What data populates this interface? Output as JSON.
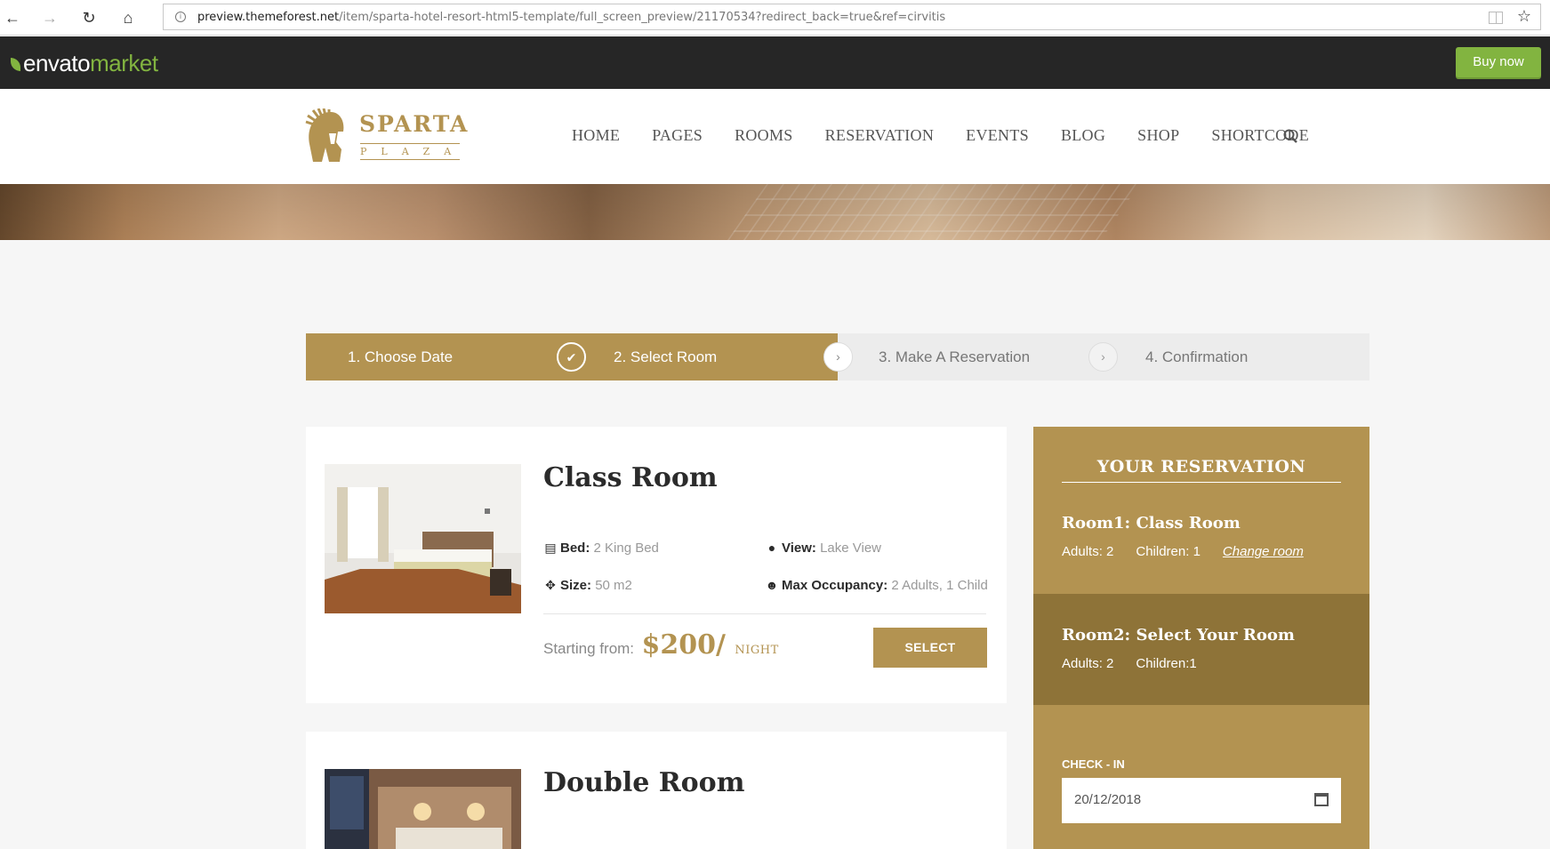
{
  "browser": {
    "url_host": "preview.themeforest.net",
    "url_path": "/item/sparta-hotel-resort-html5-template/full_screen_preview/21170534?redirect_back=true&ref=cirvitis"
  },
  "envato": {
    "logo_word": "envato",
    "logo_market": "market",
    "buy_now": "Buy now",
    "accent_color": "#82b440"
  },
  "site": {
    "brand_name": "SPARTA",
    "brand_sub": "PLAZA",
    "accent_color": "#b39351",
    "nav": [
      "Home",
      "Pages",
      "Rooms",
      "Reservation",
      "Events",
      "Blog",
      "Shop",
      "Shortcode"
    ]
  },
  "steps": [
    {
      "label": "1. Choose Date",
      "state": "done"
    },
    {
      "label": "2. Select Room",
      "state": "active"
    },
    {
      "label": "3. Make A Reservation",
      "state": "inactive"
    },
    {
      "label": "4. Confirmation",
      "state": "inactive"
    }
  ],
  "rooms": [
    {
      "name": "Class Room",
      "bed_label": "Bed:",
      "bed": "2 King Bed",
      "view_label": "View:",
      "view": "Lake View",
      "size_label": "Size:",
      "size": "50 m2",
      "occupancy_label": "Max Occupancy:",
      "occupancy": "2 Adults, 1 Child",
      "price_label": "Starting from:",
      "price": "$200/",
      "price_unit": "NIGHT",
      "select_label": "SELECT"
    },
    {
      "name": "Double Room"
    }
  ],
  "reservation": {
    "title": "YOUR RESERVATION",
    "room1_name": "Room1: Class Room",
    "room1_adults": "Adults: 2",
    "room1_children": "Children: 1",
    "change_room": "Change room",
    "room2_name": "Room2: Select Your Room",
    "room2_adults": "Adults: 2",
    "room2_children": "Children:1",
    "checkin_label": "CHECK - IN",
    "checkin_value": "20/12/2018"
  }
}
